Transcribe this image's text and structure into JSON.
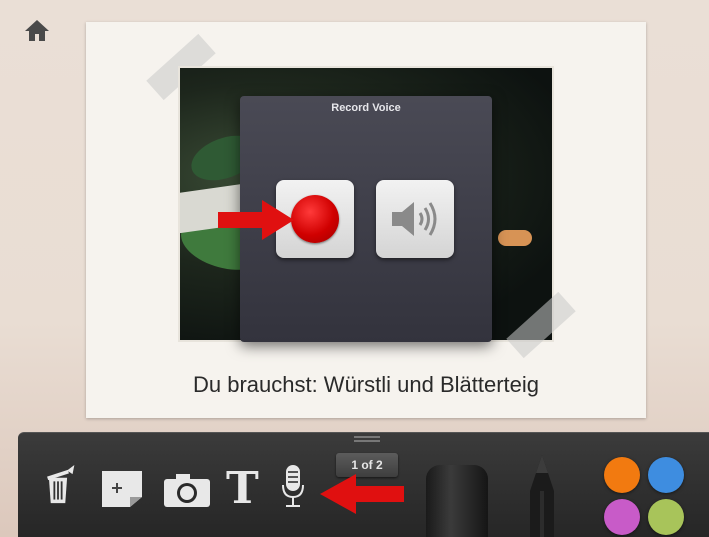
{
  "header": {
    "home_icon": "home-icon"
  },
  "page": {
    "caption": "Du brauchst: Würstli und Blätterteig"
  },
  "record_dialog": {
    "title": "Record Voice",
    "record_icon": "record-icon",
    "playback_icon": "speaker-icon"
  },
  "toolbar": {
    "page_indicator": "1 of 2",
    "tools": [
      "trash-icon",
      "add-note-icon",
      "camera-icon",
      "text-icon",
      "microphone-icon",
      "marker-icon",
      "pencil-icon"
    ],
    "colors": {
      "orange": "#f27a10",
      "blue": "#3e8de0",
      "purple": "#c85bc8",
      "green": "#a8c45a"
    }
  },
  "annotations": {
    "arrow_color": "#e01010"
  }
}
